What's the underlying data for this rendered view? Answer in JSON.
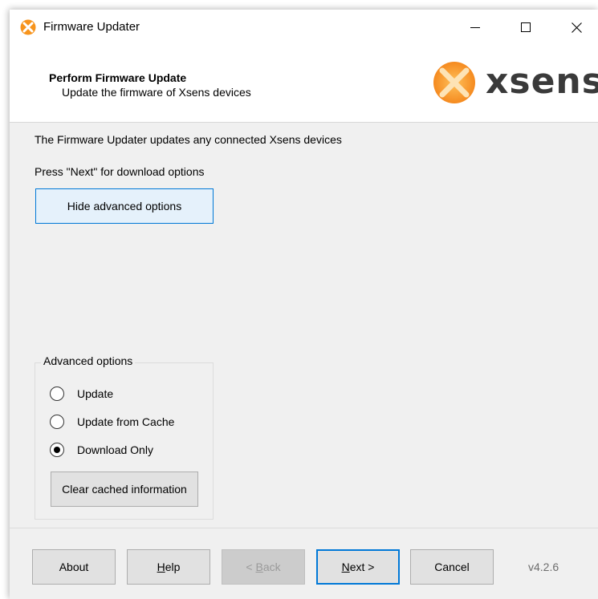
{
  "window": {
    "title": "Firmware Updater",
    "app_icon": "xsens-x-icon",
    "controls": [
      "minimize-icon",
      "maximize-icon",
      "close-icon"
    ]
  },
  "header": {
    "title": "Perform Firmware Update",
    "subtitle": "Update the firmware of Xsens devices",
    "logo_text": "xsens"
  },
  "content": {
    "line1": "The Firmware Updater updates any connected Xsens devices",
    "line2": "Press \"Next\" for download options",
    "toggle_button": "Hide advanced options"
  },
  "advanced": {
    "legend": "Advanced options",
    "options": [
      {
        "label": "Update",
        "selected": false
      },
      {
        "label": "Update from Cache",
        "selected": false
      },
      {
        "label": "Download Only",
        "selected": true
      }
    ],
    "clear_button": "Clear cached information"
  },
  "footer": {
    "about": "About",
    "help_mnemonic": "H",
    "help_rest": "elp",
    "back_prefix": "< ",
    "back_mnemonic": "B",
    "back_rest": "ack",
    "next_mnemonic": "N",
    "next_rest": "ext >",
    "cancel": "Cancel",
    "version": "v4.2.6"
  },
  "colors": {
    "accent": "#0078d7",
    "logo_orange": "#f7941d",
    "window_bg": "#f0f0f0"
  }
}
